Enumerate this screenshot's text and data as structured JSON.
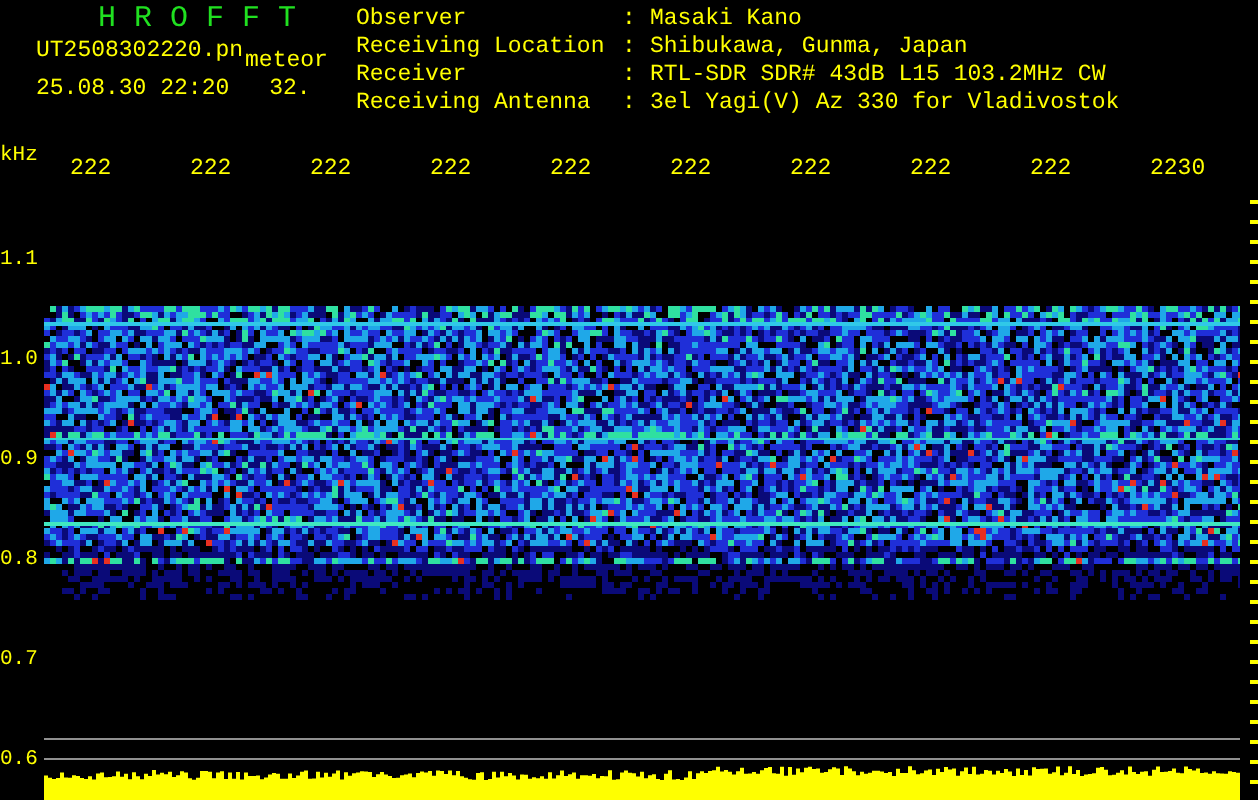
{
  "header": {
    "title": "H R O F F T",
    "filename": "UT2508302220.pn",
    "mode": "meteor",
    "datetime": "25.08.30 22:20",
    "count": "32."
  },
  "info": [
    {
      "label": "Observer",
      "colon": ":",
      "value": "Masaki Kano"
    },
    {
      "label": "Receiving Location",
      "colon": ":",
      "value": "Shibukawa, Gunma, Japan"
    },
    {
      "label": "Receiver",
      "colon": ":",
      "value": "RTL-SDR SDR# 43dB L15 103.2MHz CW"
    },
    {
      "label": "Receiving Antenna",
      "colon": ":",
      "value": "3el Yagi(V) Az 330 for Vladivostok"
    }
  ],
  "plot": {
    "unit": "kHz",
    "x_labels": [
      "222",
      "222",
      "222",
      "222",
      "222",
      "222",
      "222",
      "222",
      "222",
      "2230"
    ],
    "y_labels": [
      "1.1",
      "1.0",
      "0.9",
      "0.8",
      "0.7",
      "0.6"
    ]
  }
}
